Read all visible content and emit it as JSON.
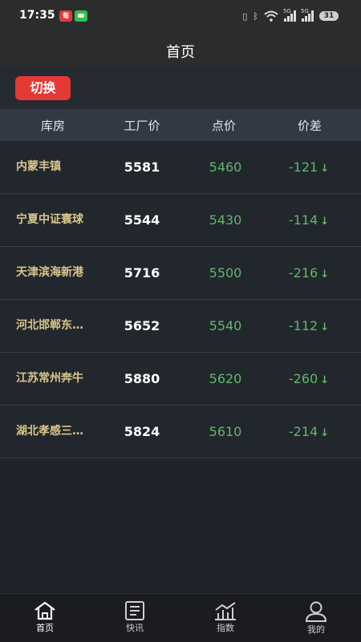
{
  "status": {
    "time": "17:35",
    "app_badge": "每",
    "net1": "5G",
    "net2": "5G",
    "battery": "31"
  },
  "nav": {
    "title": "首页"
  },
  "switch_label": "切换",
  "header": {
    "warehouse": "库房",
    "factory_price": "工厂价",
    "point_price": "点价",
    "diff": "价差"
  },
  "rows": [
    {
      "warehouse": "内蒙丰镇",
      "factory": "5581",
      "point": "5460",
      "diff": "-121"
    },
    {
      "warehouse": "宁夏中证寰球",
      "factory": "5544",
      "point": "5430",
      "diff": "-114"
    },
    {
      "warehouse": "天津滨海新港",
      "factory": "5716",
      "point": "5500",
      "diff": "-216"
    },
    {
      "warehouse": "河北邯郸东…",
      "factory": "5652",
      "point": "5540",
      "diff": "-112"
    },
    {
      "warehouse": "江苏常州奔牛",
      "factory": "5880",
      "point": "5620",
      "diff": "-260"
    },
    {
      "warehouse": "湖北孝感三…",
      "factory": "5824",
      "point": "5610",
      "diff": "-214"
    }
  ],
  "diff_arrow": "↓",
  "tabs": [
    {
      "label": "首页",
      "icon": "home-icon"
    },
    {
      "label": "快讯",
      "icon": "news-icon"
    },
    {
      "label": "指数",
      "icon": "chart-icon"
    },
    {
      "label": "我的",
      "icon": "user-icon"
    }
  ],
  "colors": {
    "accent": "#e53935",
    "up_green": "#5fb86a",
    "warehouse_gold": "#d9c68a",
    "background": "#1f2228"
  }
}
